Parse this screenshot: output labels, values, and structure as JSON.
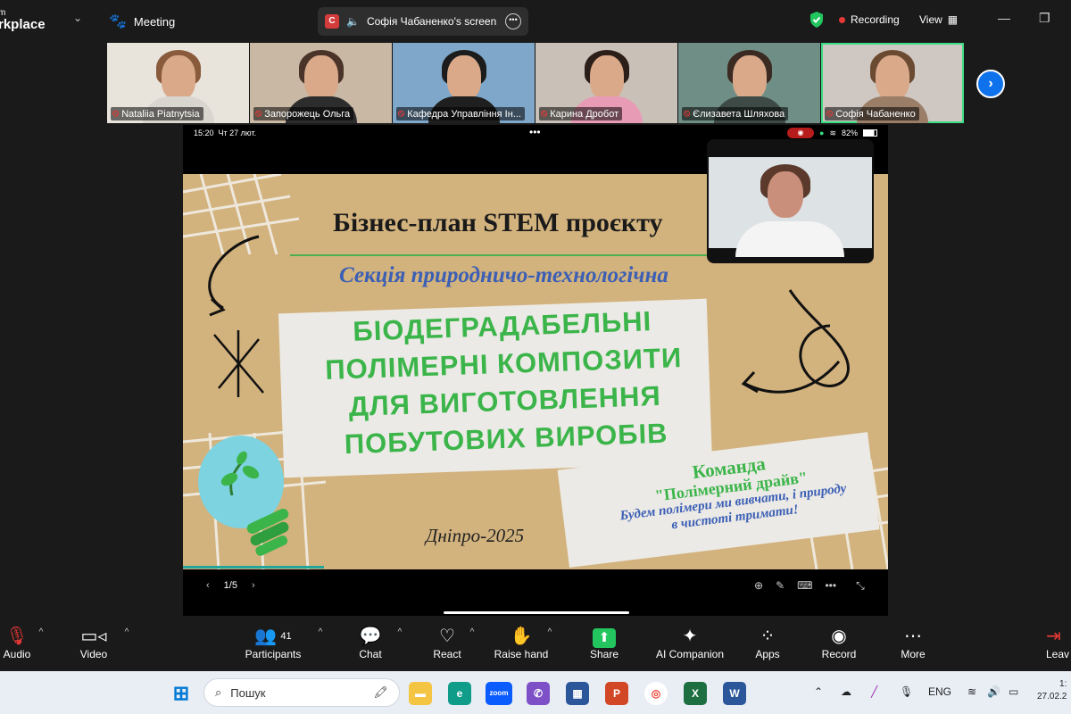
{
  "topbar": {
    "brand_line1": "m",
    "brand_line2": "rkplace",
    "meeting_label": "Meeting",
    "share_badge": "С",
    "share_title": "Софія Чабаненко's screen",
    "recording_label": "Recording",
    "view_label": "View"
  },
  "participants_strip": [
    {
      "name": "Nataliia Piatnytsia",
      "hair": "#8a5a3c",
      "body": "#d9d6cf",
      "bg": "#e8e4dc"
    },
    {
      "name": "Запорожець Ольга",
      "hair": "#4a3328",
      "body": "#2d2d2d",
      "bg": "#c9b8a4"
    },
    {
      "name": "Кафедра Управління Ін...",
      "hair": "#1c1c1c",
      "body": "#1f1f1f",
      "bg": "#7ea7c9"
    },
    {
      "name": "Карина Дробот",
      "hair": "#2c1e18",
      "body": "#e89bb5",
      "bg": "#c9c0b8"
    },
    {
      "name": "Єлизавета Шляхова",
      "hair": "#3a2a22",
      "body": "#3d4a45",
      "bg": "#6f8f86"
    },
    {
      "name": "Софія Чабаненко",
      "hair": "#6b4a32",
      "body": "#9a7e68",
      "bg": "#cfc8c2",
      "active": true
    }
  ],
  "phone": {
    "time": "15:20",
    "date": "Чт 27 лют.",
    "battery": "82%",
    "page_indicator": "1/5"
  },
  "slide": {
    "title": "Бізнес-план STEM проєкту",
    "subtitle": "Секція природничо-технологічна",
    "main_line1": "БІОДЕГРАДАБЕЛЬНІ",
    "main_line2": "ПОЛІМЕРНІ  КОМПОЗИТИ",
    "main_line3": "ДЛЯ ВИГОТОВЛЕННЯ",
    "main_line4": "ПОБУТОВИХ  ВИРОБІВ",
    "team_line1": "Команда",
    "team_line2": "\"Полімерний драйв\"",
    "motto_line1": "Будем полімери ми вивчати, і природу",
    "motto_line2": "в чистоті тримати!",
    "city": "Дніпро-2025"
  },
  "toolbar": {
    "audio": "Audio",
    "video": "Video",
    "participants": "Participants",
    "participants_count": "41",
    "chat": "Chat",
    "react": "React",
    "raise_hand": "Raise hand",
    "share": "Share",
    "ai_companion": "AI Companion",
    "apps": "Apps",
    "record": "Record",
    "more": "More",
    "leave": "Leav"
  },
  "taskbar": {
    "search_placeholder": "Пошук",
    "zoom_label": "zoom",
    "lang": "ENG",
    "clock_time": "1:",
    "clock_date": "27.02.2"
  },
  "colors": {
    "accent_green": "#3ddc84",
    "zoom_blue": "#0e72ed",
    "recording_red": "#e53935",
    "slide_green": "#3bb54a",
    "slide_blue": "#3b5fb5"
  }
}
